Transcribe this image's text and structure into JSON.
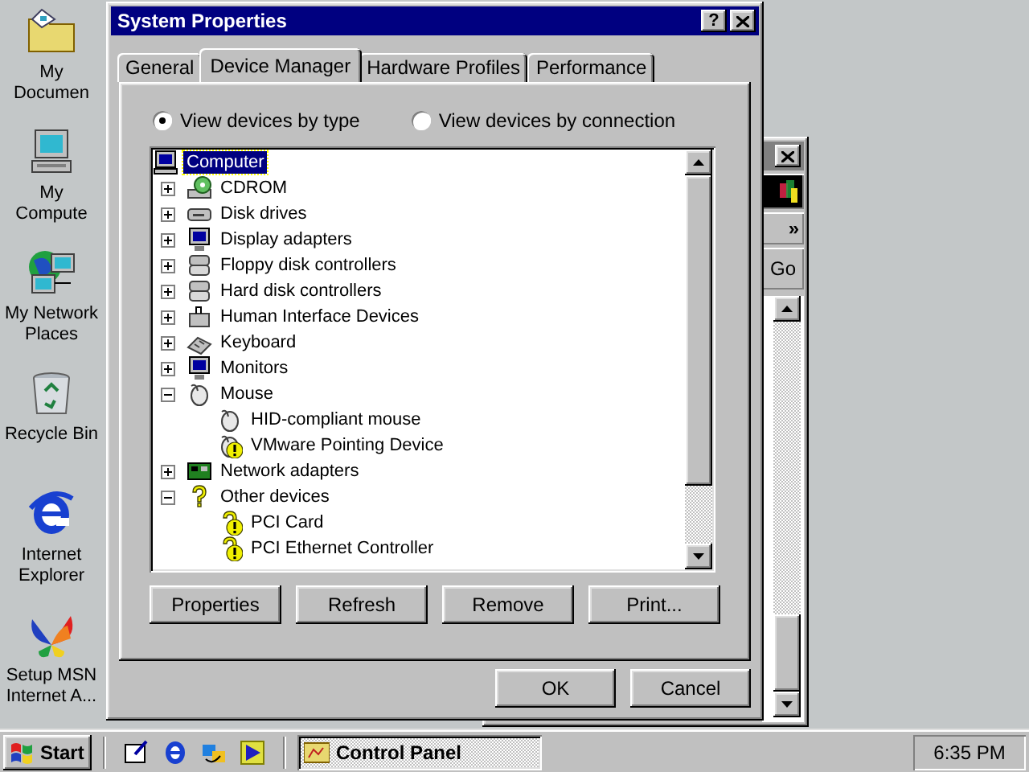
{
  "desktop_icons": [
    {
      "label": "My Documen",
      "kind": "folder"
    },
    {
      "label": "My Compute",
      "kind": "computer"
    },
    {
      "label": "My Network Places",
      "kind": "network"
    },
    {
      "label": "Recycle Bin",
      "kind": "recycle"
    },
    {
      "label": "Internet Explorer",
      "kind": "browser"
    },
    {
      "label": "Setup MSN Internet A...",
      "kind": "butterfly"
    }
  ],
  "background_window": {
    "chevron": "»",
    "go_button": "Go"
  },
  "dialog": {
    "title": "System Properties",
    "help_button": "?",
    "tabs": [
      {
        "label": "General",
        "selected": false
      },
      {
        "label": "Device Manager",
        "selected": true
      },
      {
        "label": "Hardware Profiles",
        "selected": false
      },
      {
        "label": "Performance",
        "selected": false
      }
    ],
    "view_options": [
      {
        "label": "View devices by type",
        "selected": true
      },
      {
        "label": "View devices by connection",
        "selected": false
      }
    ],
    "tree": [
      {
        "label": "Computer",
        "kind": "computer",
        "selected": true,
        "children": [
          {
            "label": "CDROM",
            "kind": "cdrom",
            "expanded": false,
            "selected": false
          },
          {
            "label": "Disk drives",
            "kind": "disk",
            "expanded": false,
            "selected": false
          },
          {
            "label": "Display adapters",
            "kind": "display",
            "expanded": false,
            "selected": false
          },
          {
            "label": "Floppy disk controllers",
            "kind": "controller",
            "expanded": false,
            "selected": false
          },
          {
            "label": "Hard disk controllers",
            "kind": "controller",
            "expanded": false,
            "selected": false
          },
          {
            "label": "Human Interface Devices",
            "kind": "hid",
            "expanded": false,
            "selected": false
          },
          {
            "label": "Keyboard",
            "kind": "keyboard",
            "expanded": false,
            "selected": false
          },
          {
            "label": "Monitors",
            "kind": "display",
            "expanded": false,
            "selected": false
          },
          {
            "label": "Mouse",
            "kind": "mouse",
            "expanded": true,
            "selected": false,
            "children": [
              {
                "label": "HID-compliant mouse",
                "kind": "mouse",
                "problem": false,
                "selected": false
              },
              {
                "label": "VMware Pointing Device",
                "kind": "mouse",
                "problem": true,
                "selected": false
              }
            ]
          },
          {
            "label": "Network adapters",
            "kind": "network",
            "expanded": false,
            "selected": false
          },
          {
            "label": "Other devices",
            "kind": "unknown",
            "expanded": true,
            "selected": false,
            "children": [
              {
                "label": "PCI Card",
                "kind": "unknown",
                "problem": true,
                "selected": false
              },
              {
                "label": "PCI Ethernet Controller",
                "kind": "unknown",
                "problem": true,
                "selected": false
              }
            ]
          }
        ]
      }
    ],
    "buttons": [
      "Properties",
      "Refresh",
      "Remove",
      "Print..."
    ],
    "dialog_buttons": [
      "OK",
      "Cancel"
    ]
  },
  "taskbar": {
    "start": "Start",
    "tasks": [
      {
        "label": "Control Panel",
        "selected": true
      }
    ],
    "clock": "6:35 PM"
  }
}
